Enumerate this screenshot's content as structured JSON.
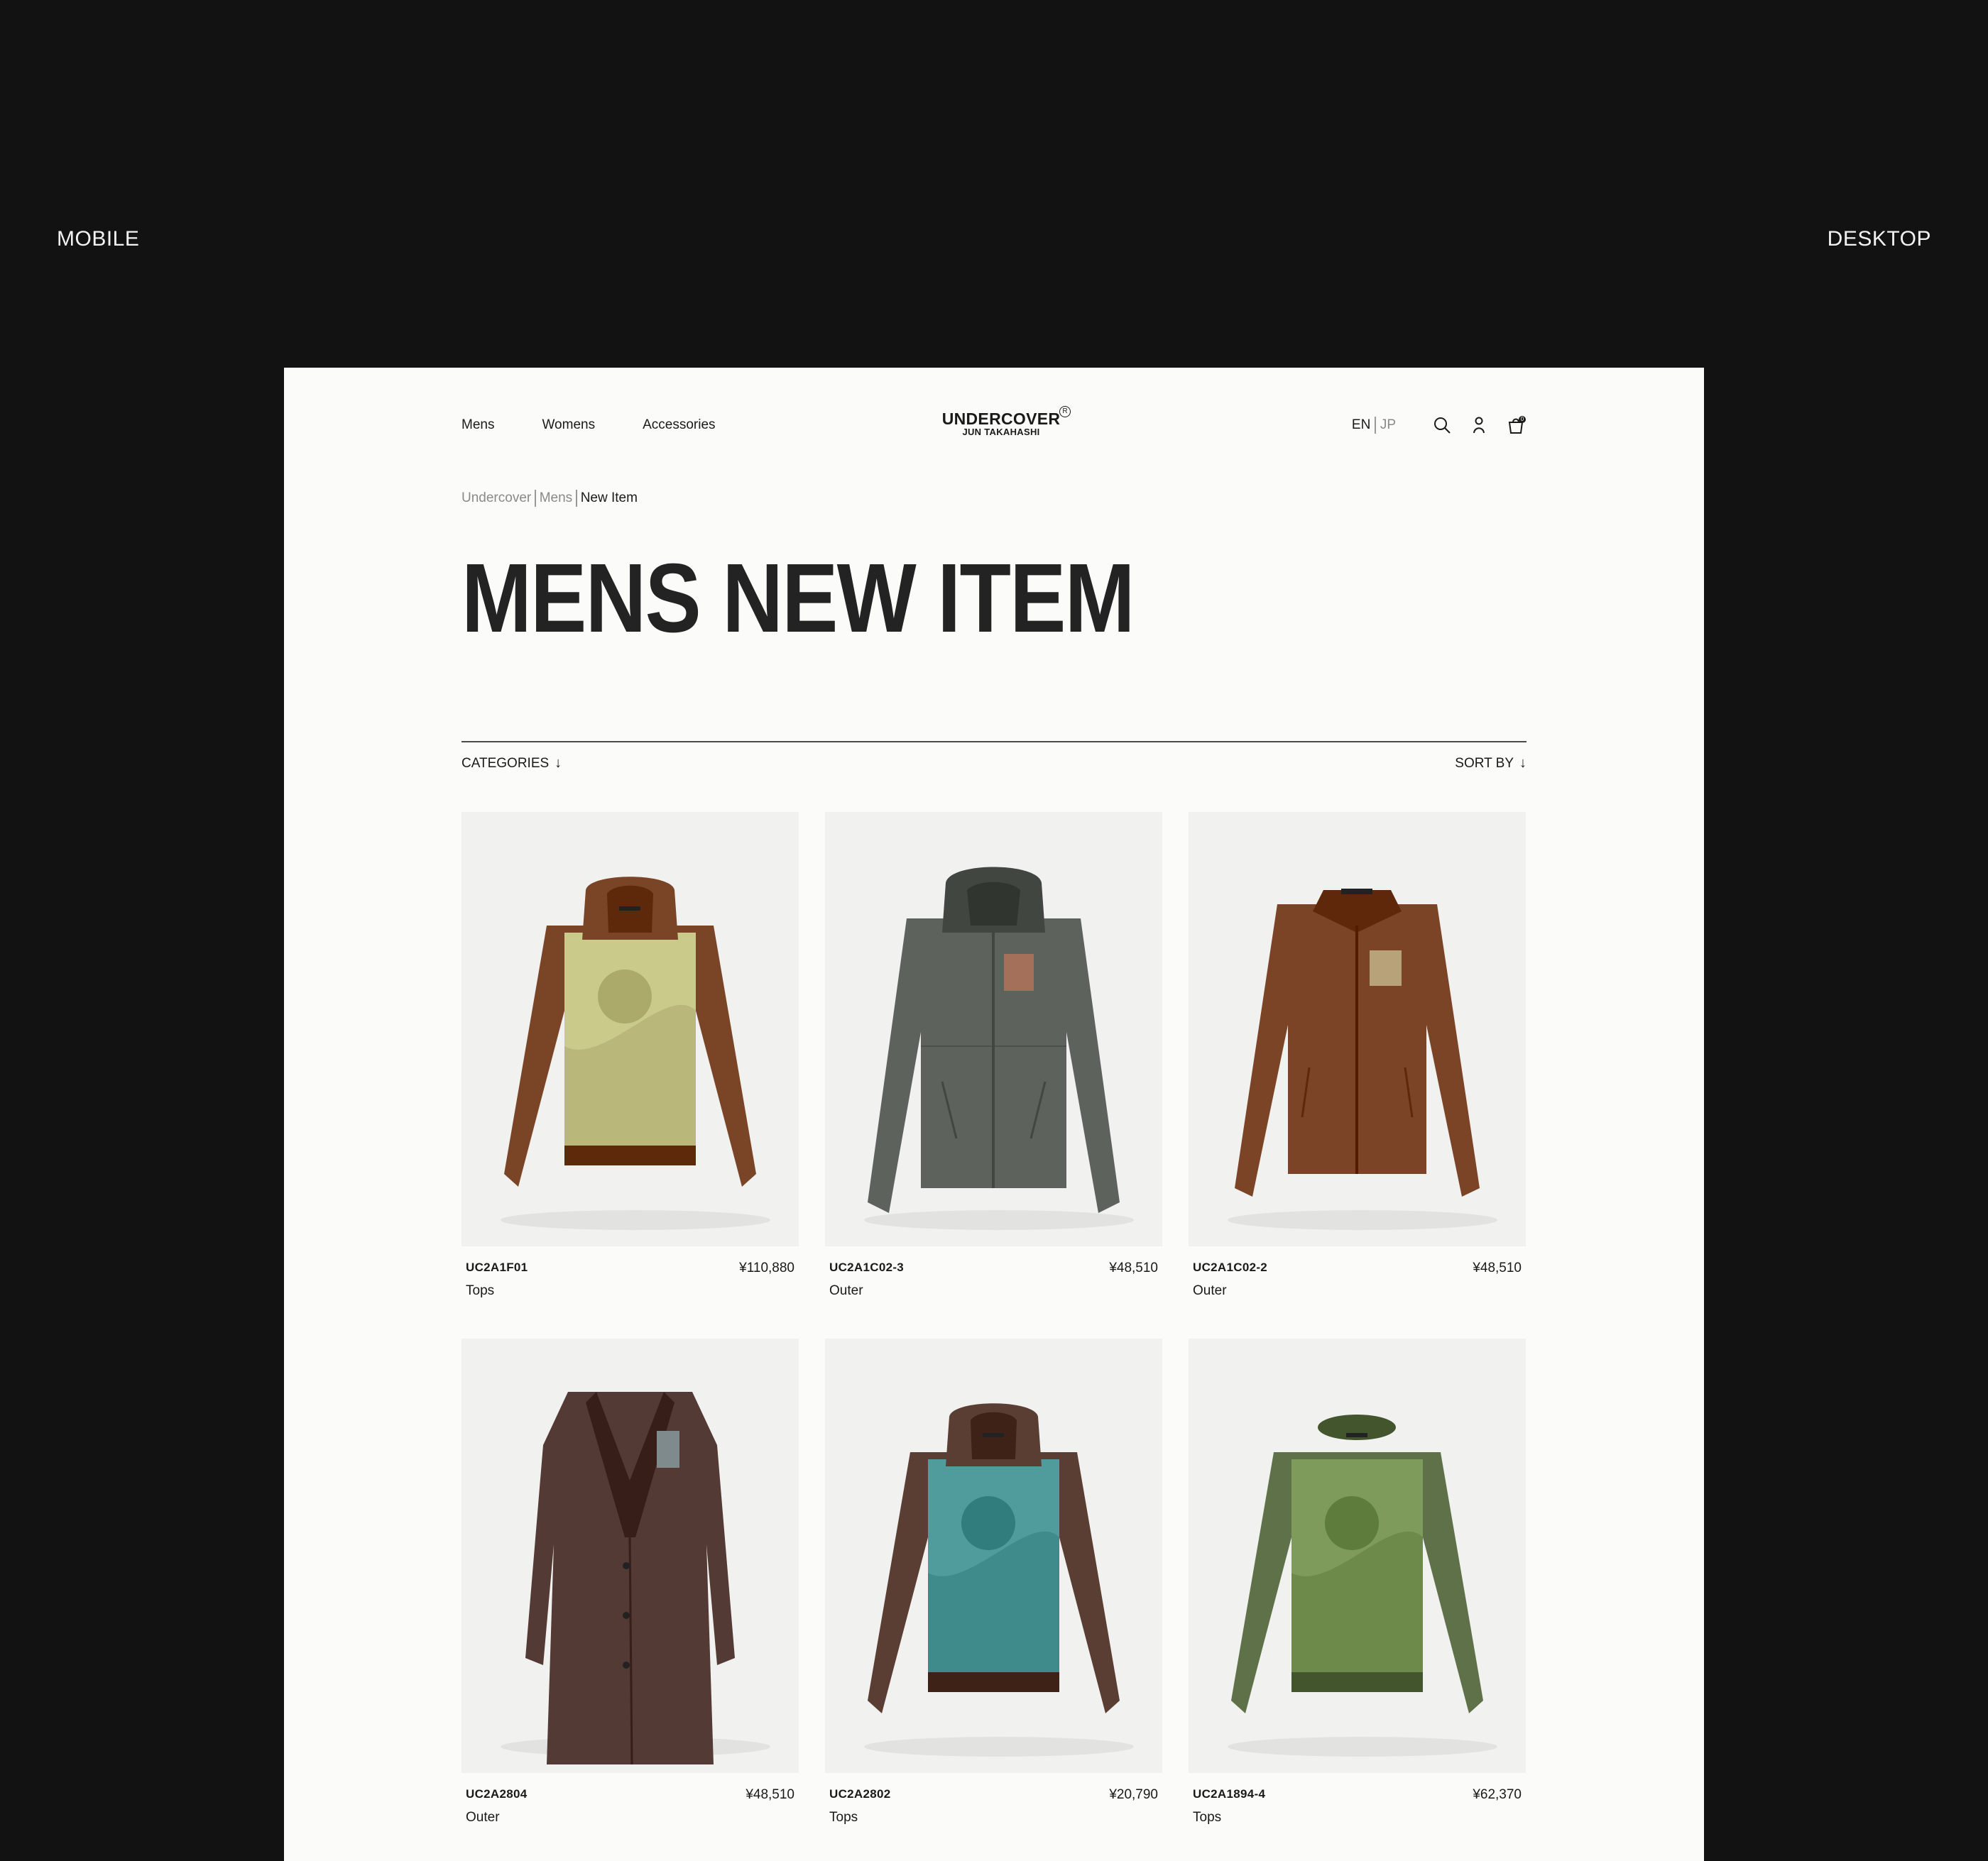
{
  "modes": {
    "mobile": "MOBILE",
    "desktop": "DESKTOP"
  },
  "nav": {
    "items": [
      "Mens",
      "Womens",
      "Accessories"
    ]
  },
  "logo": {
    "main": "UNDERCOVER",
    "registered": "R",
    "sub": "JUN TAKAHASHI"
  },
  "lang": {
    "active": "EN",
    "inactive": "JP"
  },
  "cart": {
    "count": "0"
  },
  "breadcrumb": {
    "items": [
      "Undercover",
      "Mens"
    ],
    "current": "New Item"
  },
  "page": {
    "title": "MENS NEW ITEM"
  },
  "filters": {
    "categories": "CATEGORIES",
    "sort": "SORT BY",
    "arrow": "↓"
  },
  "products": [
    {
      "code": "UC2A1F01",
      "price": "¥110,880",
      "category": "Tops",
      "garment": "hoodie-print",
      "colors": {
        "main": "#7a4526",
        "print": "#b9b87a"
      }
    },
    {
      "code": "UC2A1C02-3",
      "price": "¥48,510",
      "category": "Outer",
      "garment": "puffer-jacket",
      "colors": {
        "main": "#5e625c",
        "print": "#a4705a"
      }
    },
    {
      "code": "UC2A1C02-2",
      "price": "¥48,510",
      "category": "Outer",
      "garment": "zip-jacket",
      "colors": {
        "main": "#7b4426",
        "print": "#b7a27a"
      }
    },
    {
      "code": "UC2A2804",
      "price": "¥48,510",
      "category": "Outer",
      "garment": "long-coat",
      "colors": {
        "main": "#533a34",
        "print": "#7f8a8c"
      }
    },
    {
      "code": "UC2A2802",
      "price": "¥20,790",
      "category": "Tops",
      "garment": "hoodie-print",
      "colors": {
        "main": "#5a3e33",
        "print": "#3f8a8a"
      }
    },
    {
      "code": "UC2A1894-4",
      "price": "¥62,370",
      "category": "Tops",
      "garment": "crewneck-print",
      "colors": {
        "main": "#5f7148",
        "print": "#6d8a4a"
      }
    }
  ]
}
